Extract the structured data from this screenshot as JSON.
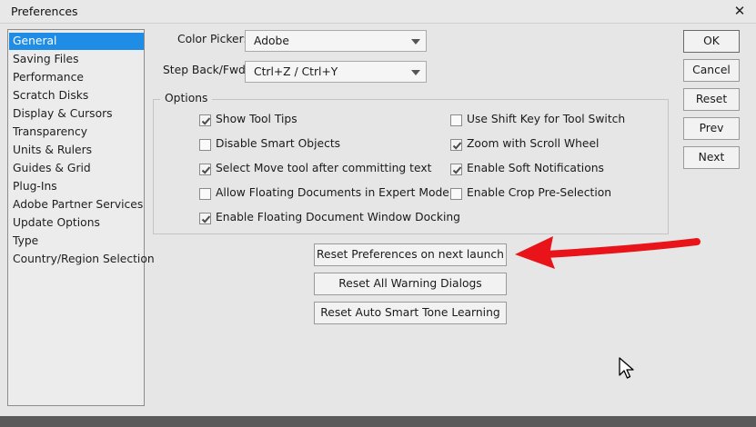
{
  "window": {
    "title": "Preferences"
  },
  "sidebar": {
    "items": [
      {
        "label": "General",
        "active": true
      },
      {
        "label": "Saving Files"
      },
      {
        "label": "Performance"
      },
      {
        "label": "Scratch Disks"
      },
      {
        "label": "Display & Cursors"
      },
      {
        "label": "Transparency"
      },
      {
        "label": "Units & Rulers"
      },
      {
        "label": "Guides & Grid"
      },
      {
        "label": "Plug-Ins"
      },
      {
        "label": "Adobe Partner Services"
      },
      {
        "label": "Update Options"
      },
      {
        "label": "Type"
      },
      {
        "label": "Country/Region Selection"
      }
    ]
  },
  "fields": {
    "color_picker": {
      "label": "Color Picker:",
      "value": "Adobe"
    },
    "step_back": {
      "label": "Step Back/Fwd:",
      "value": "Ctrl+Z / Ctrl+Y"
    }
  },
  "options": {
    "legend": "Options",
    "left": [
      {
        "label": "Show Tool Tips",
        "checked": true
      },
      {
        "label": "Disable Smart Objects",
        "checked": false
      },
      {
        "label": "Select Move tool after committing text",
        "checked": true
      },
      {
        "label": "Allow Floating Documents in Expert Mode",
        "checked": false
      },
      {
        "label": "Enable Floating Document Window Docking",
        "checked": true
      }
    ],
    "right": [
      {
        "label": "Use Shift Key for Tool Switch",
        "checked": false
      },
      {
        "label": "Zoom with Scroll Wheel",
        "checked": true
      },
      {
        "label": "Enable Soft Notifications",
        "checked": true
      },
      {
        "label": "Enable Crop Pre-Selection",
        "checked": false
      }
    ]
  },
  "reset_buttons": {
    "prefs": "Reset Preferences on next launch",
    "warnings": "Reset All Warning Dialogs",
    "smart_tone": "Reset Auto Smart Tone Learning"
  },
  "side_buttons": {
    "ok": "OK",
    "cancel": "Cancel",
    "reset": "Reset",
    "prev": "Prev",
    "next": "Next"
  },
  "colors": {
    "selection": "#1f8ce6",
    "annotation_arrow": "#e8141a"
  },
  "icons": {
    "close": "close-icon",
    "checkmark": "checkmark-icon",
    "dropdown": "chevron-down-icon",
    "cursor": "mouse-pointer-icon",
    "annotation": "red-arrow-annotation"
  }
}
